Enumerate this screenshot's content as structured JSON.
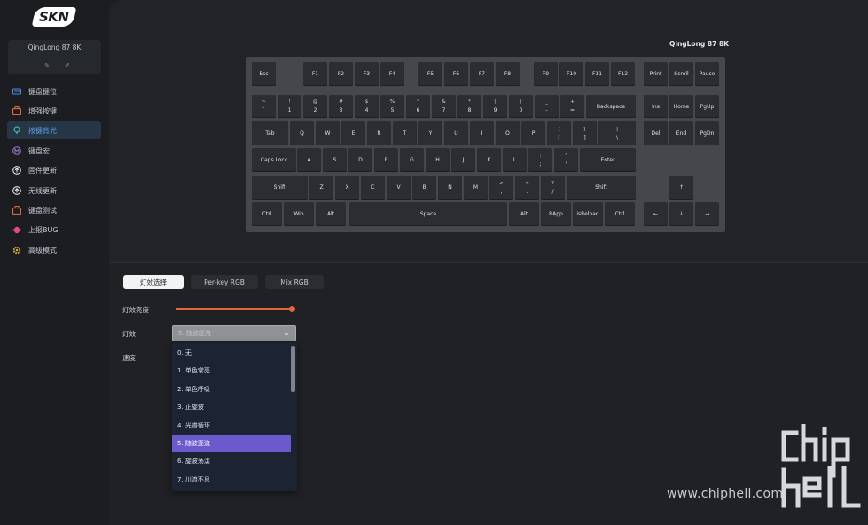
{
  "brand": {
    "logo_text": "SKN"
  },
  "device": {
    "name": "QingLong 87 8K"
  },
  "sidebar": {
    "items": [
      {
        "label": "键盘键位",
        "icon": "keyboard-icon",
        "color": "#4a8fd9"
      },
      {
        "label": "增强按键",
        "icon": "toolbox-icon",
        "color": "#e0683a"
      },
      {
        "label": "按键背光",
        "icon": "bulb-icon",
        "color": "#3fb8a8",
        "active": true
      },
      {
        "label": "键盘宏",
        "icon": "macro-m-icon",
        "color": "#a07bd0"
      },
      {
        "label": "固件更新",
        "icon": "upload-circle-icon",
        "color": "#e6e6e6"
      },
      {
        "label": "无线更新",
        "icon": "upload-circle-icon",
        "color": "#e6e6e6"
      },
      {
        "label": "键盘测试",
        "icon": "toolbox-icon",
        "color": "#e0683a"
      },
      {
        "label": "上报BUG",
        "icon": "bug-icon",
        "color": "#e64a8b"
      },
      {
        "label": "高级模式",
        "icon": "gear-icon",
        "color": "#e0b43a"
      }
    ]
  },
  "keyboard": {
    "title": "QingLong 87 8K",
    "keys": [
      {
        "t": "",
        "b": "Esc"
      },
      {
        "t": "",
        "b": "F1"
      },
      {
        "t": "",
        "b": "F2"
      },
      {
        "t": "",
        "b": "F3"
      },
      {
        "t": "",
        "b": "F4"
      },
      {
        "t": "",
        "b": "F5"
      },
      {
        "t": "",
        "b": "F6"
      },
      {
        "t": "",
        "b": "F7"
      },
      {
        "t": "",
        "b": "F8"
      },
      {
        "t": "",
        "b": "F9"
      },
      {
        "t": "",
        "b": "F10"
      },
      {
        "t": "",
        "b": "F11"
      },
      {
        "t": "",
        "b": "F12"
      },
      {
        "t": "",
        "b": "Print"
      },
      {
        "t": "",
        "b": "Scroll"
      },
      {
        "t": "",
        "b": "Pause"
      },
      {
        "t": "~",
        "b": "`"
      },
      {
        "t": "!",
        "b": "1"
      },
      {
        "t": "@",
        "b": "2"
      },
      {
        "t": "#",
        "b": "3"
      },
      {
        "t": "$",
        "b": "4"
      },
      {
        "t": "%",
        "b": "5"
      },
      {
        "t": "^",
        "b": "6"
      },
      {
        "t": "&",
        "b": "7"
      },
      {
        "t": "*",
        "b": "8"
      },
      {
        "t": "(",
        "b": "9"
      },
      {
        "t": ")",
        "b": "0"
      },
      {
        "t": "_",
        "b": "-"
      },
      {
        "t": "+",
        "b": "="
      },
      {
        "t": "",
        "b": "Backspace"
      },
      {
        "t": "",
        "b": "Ins"
      },
      {
        "t": "",
        "b": "Home"
      },
      {
        "t": "",
        "b": "PgUp"
      },
      {
        "t": "",
        "b": "Tab"
      },
      {
        "t": "",
        "b": "Q"
      },
      {
        "t": "",
        "b": "W"
      },
      {
        "t": "",
        "b": "E"
      },
      {
        "t": "",
        "b": "R"
      },
      {
        "t": "",
        "b": "T"
      },
      {
        "t": "",
        "b": "Y"
      },
      {
        "t": "",
        "b": "U"
      },
      {
        "t": "",
        "b": "I"
      },
      {
        "t": "",
        "b": "O"
      },
      {
        "t": "",
        "b": "P"
      },
      {
        "t": "{",
        "b": "["
      },
      {
        "t": "}",
        "b": "]"
      },
      {
        "t": "|",
        "b": "\\"
      },
      {
        "t": "",
        "b": "Del"
      },
      {
        "t": "",
        "b": "End"
      },
      {
        "t": "",
        "b": "PgDn"
      },
      {
        "t": "",
        "b": "Caps Lock"
      },
      {
        "t": "",
        "b": "A"
      },
      {
        "t": "",
        "b": "S"
      },
      {
        "t": "",
        "b": "D"
      },
      {
        "t": "",
        "b": "F"
      },
      {
        "t": "",
        "b": "G"
      },
      {
        "t": "",
        "b": "H"
      },
      {
        "t": "",
        "b": "J"
      },
      {
        "t": "",
        "b": "K"
      },
      {
        "t": "",
        "b": "L"
      },
      {
        "t": ":",
        "b": ";"
      },
      {
        "t": "\"",
        "b": "'"
      },
      {
        "t": "",
        "b": "Enter"
      },
      {
        "t": "",
        "b": "Shift"
      },
      {
        "t": "",
        "b": "Z"
      },
      {
        "t": "",
        "b": "X"
      },
      {
        "t": "",
        "b": "C"
      },
      {
        "t": "",
        "b": "V"
      },
      {
        "t": "",
        "b": "B"
      },
      {
        "t": "",
        "b": "N"
      },
      {
        "t": "",
        "b": "M"
      },
      {
        "t": "<",
        "b": ","
      },
      {
        "t": ">",
        "b": "."
      },
      {
        "t": "?",
        "b": "/"
      },
      {
        "t": "",
        "b": "Shift"
      },
      {
        "t": "",
        "b": "↑"
      },
      {
        "t": "",
        "b": "Ctrl"
      },
      {
        "t": "",
        "b": "Win"
      },
      {
        "t": "",
        "b": "Alt"
      },
      {
        "t": "",
        "b": "Space"
      },
      {
        "t": "",
        "b": "Alt"
      },
      {
        "t": "",
        "b": "RApp"
      },
      {
        "t": "",
        "b": "isReload"
      },
      {
        "t": "",
        "b": "Ctrl"
      },
      {
        "t": "",
        "b": "←"
      },
      {
        "t": "",
        "b": "↓"
      },
      {
        "t": "",
        "b": "→"
      }
    ]
  },
  "tabs": [
    {
      "label": "灯效选择",
      "active": true
    },
    {
      "label": "Per-key RGB",
      "active": false
    },
    {
      "label": "Mix RGB",
      "active": false
    }
  ],
  "form": {
    "brightness_label": "灯效亮度",
    "brightness_value": 1.0,
    "effect_label": "灯效",
    "effect_selected": "5. 随波逐流",
    "speed_label": "速度"
  },
  "dropdown_options": [
    "0. 无",
    "1. 单色常亮",
    "2. 单色呼吸",
    "3. 正旋波",
    "4. 光谱循环",
    "5. 随波逐流",
    "6. 旋波荡漾",
    "7. 川流不息"
  ],
  "dropdown_selected_index": 5,
  "colors": {
    "accent_orange": "#e8643f",
    "selection_purple": "#6a5acd",
    "active_nav": "#5ea0e6"
  },
  "watermark": {
    "text": "www.chiphell.com",
    "logo_text": "chip hell"
  }
}
